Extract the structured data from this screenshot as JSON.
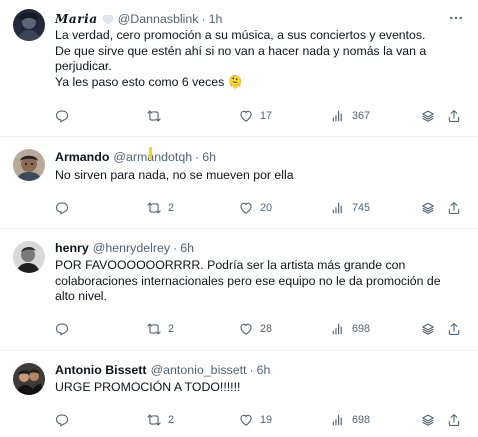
{
  "tweets": [
    {
      "name": "Maria",
      "handle": "@Dannasblink",
      "time": "1h",
      "lines": [
        "La verdad, cero promoción a su música, a sus conciertos y eventos.",
        "De que sirve que estén ahí si no van a hacer nada y nomás la van a",
        "perjudicar.",
        "Ya les paso esto como 6 veces"
      ],
      "emoji": "🫠",
      "reply_count": "",
      "retweet_count": "",
      "like_count": "17",
      "view_count": "367"
    },
    {
      "name": "Armando",
      "handle": "@armandotqh",
      "time": "6h",
      "lines": [
        "No sirven para nada, no se mueven por ella"
      ],
      "reply_count": "",
      "retweet_count": "2",
      "like_count": "20",
      "view_count": "745"
    },
    {
      "name": "henry",
      "handle": "@henrydelrey",
      "time": "6h",
      "lines": [
        "POR FAVOOOOOORRRR. Podría ser la artista más grande con",
        "colaboraciones internacionales pero ese equipo no le da promoción de",
        "alto nivel."
      ],
      "reply_count": "",
      "retweet_count": "2",
      "like_count": "28",
      "view_count": "698"
    },
    {
      "name": "Antonio Bissett",
      "handle": "@antonio_bissett",
      "time": "6h",
      "lines": [
        "URGE PROMOCIÓN A TODO!!!!!!"
      ],
      "reply_count": "",
      "retweet_count": "2",
      "like_count": "19",
      "view_count": "698"
    }
  ],
  "separator": "·",
  "colors": {
    "text": "#0f1419",
    "secondary": "#536471",
    "divider": "#eff3f4",
    "highlight": "#f5d90a"
  },
  "icons": [
    "more-icon",
    "reply-icon",
    "retweet-icon",
    "like-icon",
    "views-icon",
    "bookmark-icon",
    "share-icon",
    "heart-icon"
  ]
}
